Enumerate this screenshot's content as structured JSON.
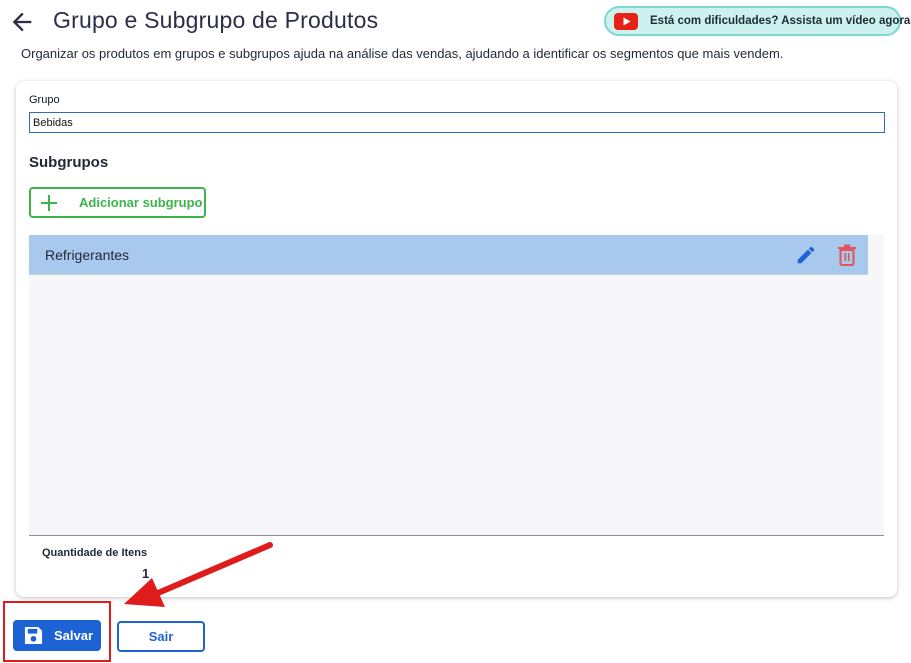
{
  "header": {
    "title": "Grupo e Subgrupo de Produtos",
    "back_icon": "arrow-left-icon",
    "subtitle": "Organizar os produtos em grupos e subgrupos ajuda na análise das vendas, ajudando a identificar os segmentos que mais vendem."
  },
  "help": {
    "label": "Está com dificuldades? Assista um vídeo agora!",
    "icon": "youtube-icon"
  },
  "form": {
    "group_label": "Grupo",
    "group_value": "Bebidas",
    "subgroups_title": "Subgrupos",
    "add_button_label": "Adicionar subgrupo"
  },
  "subgroups": {
    "items": [
      {
        "label": "Refrigerantes",
        "edit_icon": "pencil-icon",
        "delete_icon": "trash-icon"
      }
    ],
    "count_label": "Quantidade de Itens",
    "count_value": "1"
  },
  "actions": {
    "save_label": "Salvar",
    "exit_label": "Sair"
  },
  "colors": {
    "primary": "#1e63d6",
    "success": "#3db54a",
    "danger": "#e0565b",
    "selected_row": "#a8c8ee",
    "annotation": "#e01b1b",
    "help_bg": "#cdf1ee"
  }
}
